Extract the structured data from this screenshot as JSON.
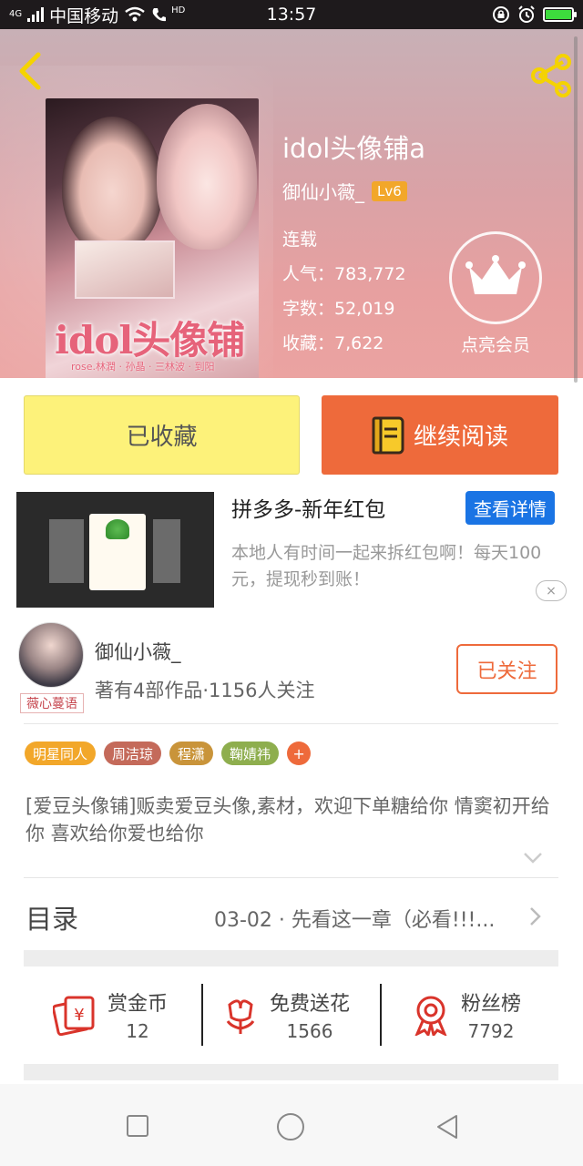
{
  "status_bar": {
    "network": "4G",
    "carrier": "中国移动",
    "hd": "HD",
    "time": "13:57"
  },
  "book": {
    "title": "idol头像铺a",
    "author": "御仙小薇_",
    "level": "Lv6",
    "status": "连载",
    "popularity": "人气：783,772",
    "word_count": "字数：52,019",
    "favorites": "收藏：7,622",
    "vip_label": "点亮会员",
    "cover": {
      "title": "idol头像铺",
      "subtitle": "rose.林潤 · 孙晶 · 三林波 · 到阳"
    }
  },
  "actions": {
    "collected": "已收藏",
    "continue_reading": "继续阅读"
  },
  "ad": {
    "title": "拼多多-新年红包",
    "details_button": "查看详情",
    "description": "本地人有时间一起来拆红包啊！每天100元，提现秒到账！",
    "close": "×"
  },
  "author_card": {
    "avatar_tag": "薇心蔓语",
    "name": "御仙小薇_",
    "stats": "著有4部作品·1156人关注",
    "follow_button": "已关注"
  },
  "tags": [
    {
      "label": "明星同人",
      "color": "#f2a72a"
    },
    {
      "label": "周洁琼",
      "color": "#c46a5a"
    },
    {
      "label": "程潇",
      "color": "#c9943a"
    },
    {
      "label": "鞠婧祎",
      "color": "#8eae4e"
    }
  ],
  "tag_add": "+",
  "description": "[爱豆头像铺]贩卖爱豆头像,素材，欢迎下单糖给你 情窦初开给你 喜欢给你爱也给你",
  "catalog": {
    "label": "目录",
    "latest": "03-02 · 先看这一章（必看!!!..."
  },
  "stats": {
    "reward": {
      "label": "赏金币",
      "value": "12"
    },
    "flowers": {
      "label": "免费送花",
      "value": "1566"
    },
    "fans": {
      "label": "粉丝榜",
      "value": "7792"
    }
  },
  "colors": {
    "accent": "#ee6a3b",
    "collected_bg": "#fdf27a",
    "ad_button": "#1a74e4",
    "level_badge": "#f2a72a",
    "icon_red": "#d9342b"
  }
}
